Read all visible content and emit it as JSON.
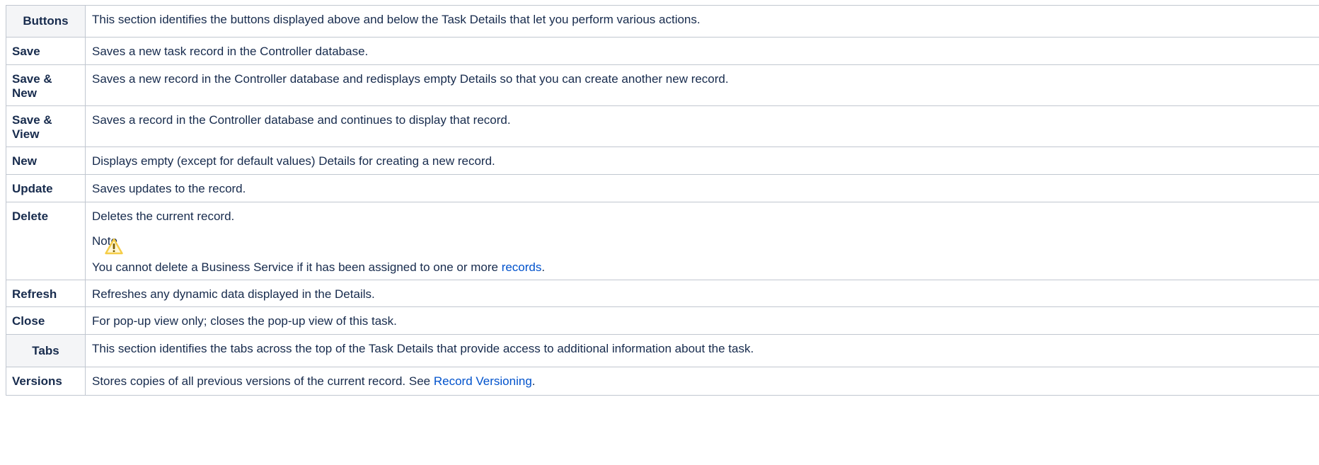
{
  "table": {
    "buttons_section": {
      "label": "Buttons",
      "description": "This section identifies the buttons displayed above and below the Task Details that let you perform various actions."
    },
    "rows": [
      {
        "label": "Save",
        "description": "Saves a new task record in the Controller database."
      },
      {
        "label": "Save & New",
        "description": "Saves a new record in the Controller database and redisplays empty Details so that you can create another new record."
      },
      {
        "label": "Save & View",
        "description": "Saves a record in the Controller database and continues to display that record."
      },
      {
        "label": "New",
        "description": "Displays empty (except for default values) Details for creating a new record."
      },
      {
        "label": "Update",
        "description": "Saves updates to the record."
      },
      {
        "label": "Delete",
        "description": "Deletes the current record.",
        "note_title": "Note",
        "note_text": "You cannot delete a Business Service if it has been assigned to one or more ",
        "note_link": "records",
        "note_tail": "."
      },
      {
        "label": "Refresh",
        "description": "Refreshes any dynamic data displayed in the Details."
      },
      {
        "label": "Close",
        "description": "For pop-up view only; closes the pop-up view of this task."
      }
    ],
    "tabs_section": {
      "label": "Tabs",
      "description": "This section identifies the tabs across the top of the Task Details that provide access to additional information about the task."
    },
    "versions_row": {
      "label": "Versions",
      "description": "Stores copies of all previous versions of the current record. See ",
      "link": "Record Versioning",
      "tail": "."
    }
  },
  "colors": {
    "border": "#c1c7d0",
    "section_bg": "#f4f5f7",
    "link": "#0052cc",
    "warning_icon": "#f5cd47"
  },
  "icons": {
    "note_icon": "warning-triangle-icon"
  }
}
